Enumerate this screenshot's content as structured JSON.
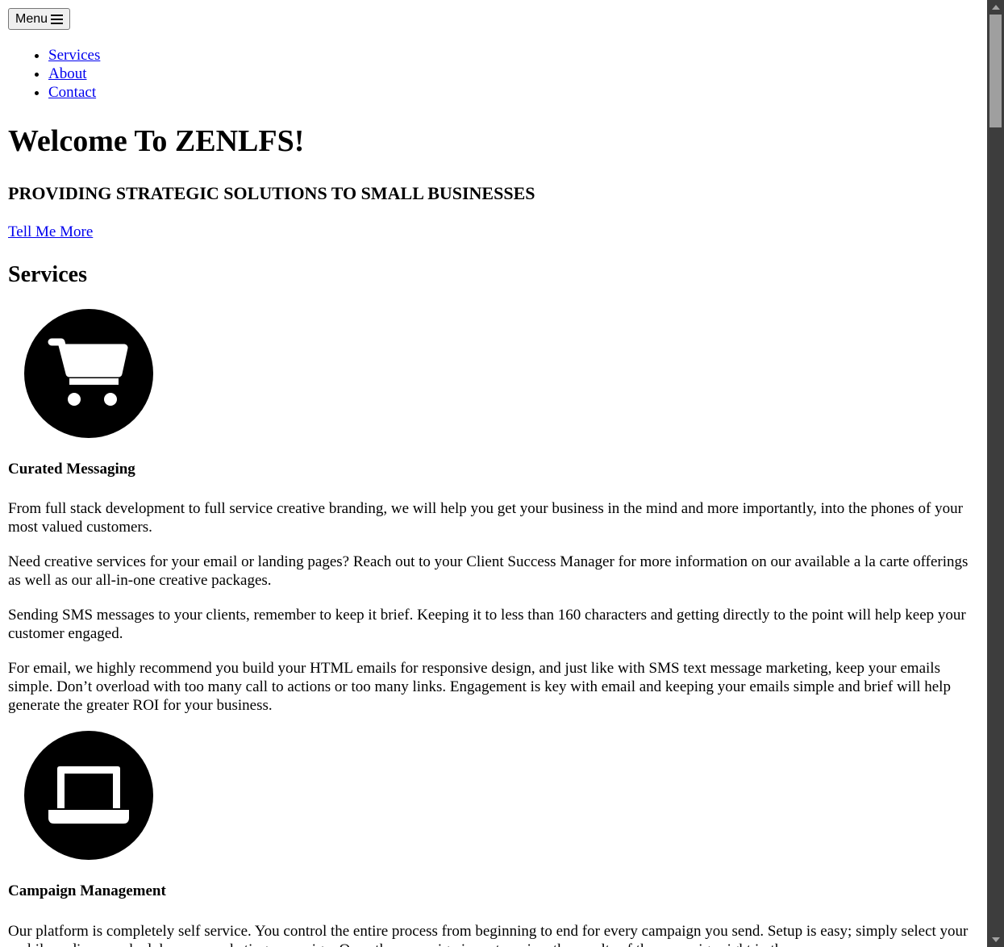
{
  "menu_button": {
    "label": "Menu",
    "icon": "hamburger-icon"
  },
  "nav": {
    "items": [
      {
        "label": "Services"
      },
      {
        "label": "About"
      },
      {
        "label": "Contact"
      }
    ]
  },
  "hero": {
    "title": "Welcome To ZENLFS!",
    "subtitle": "PROVIDING STRATEGIC SOLUTIONS TO SMALL BUSINESSES",
    "cta_label": "Tell Me More"
  },
  "services": {
    "heading": "Services",
    "items": [
      {
        "icon": "shopping-cart-icon",
        "title": "Curated Messaging",
        "paragraphs": [
          "From full stack development to full service creative branding, we will help you get your business in the mind and more importantly, into the phones of your most valued customers.",
          "Need creative services for your email or landing pages? Reach out to your Client Success Manager for more information on our available a la carte offerings as well as our all-in-one creative packages.",
          "Sending SMS messages to your clients, remember to keep it brief. Keeping it to less than 160 characters and getting directly to the point will help keep your customer engaged.",
          "For email, we highly recommend you build your HTML emails for responsive design, and just like with SMS text message marketing, keep your emails simple. Don’t overload with too many call to actions or too many links. Engagement is key with email and keeping your emails simple and brief will help generate the greater ROI for your business."
        ]
      },
      {
        "icon": "laptop-icon",
        "title": "Campaign Management",
        "paragraphs": [
          "Our platform is completely self service. You control the entire process from beginning to end for every campaign you send. Setup is easy; simply select your mobile audience, schedule your marketing campaign. Once the campaign is sent, review the results of the campaign right in the"
        ]
      }
    ]
  },
  "colors": {
    "link": "#0000ee",
    "text": "#000000",
    "scrollbar_track": "#3d3d3d",
    "scrollbar_thumb": "#9f9f9f"
  }
}
